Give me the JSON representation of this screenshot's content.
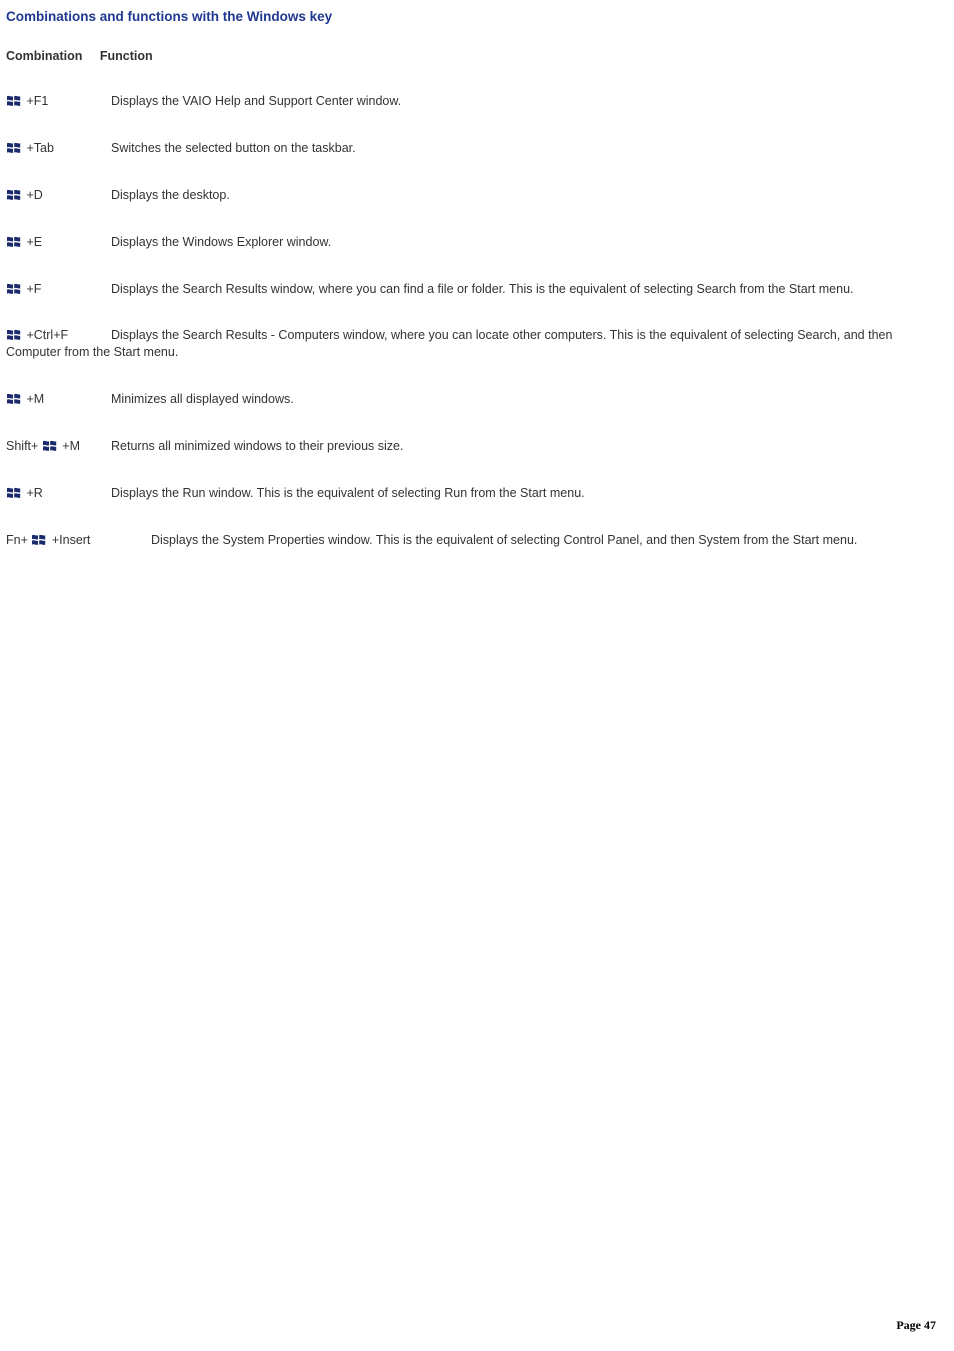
{
  "title": "Combinations and functions with the Windows key",
  "columns": {
    "a": "Combination",
    "b": "Function"
  },
  "rows": [
    {
      "prefix": "",
      "suffix": " +F1",
      "func": "Displays the VAIO Help and Support Center window."
    },
    {
      "prefix": "",
      "suffix": " +Tab",
      "func": "Switches the selected button on the taskbar."
    },
    {
      "prefix": "",
      "suffix": " +D",
      "func": "Displays the desktop."
    },
    {
      "prefix": "",
      "suffix": " +E",
      "func": "Displays the Windows Explorer window."
    },
    {
      "prefix": "",
      "suffix": " +F",
      "func": "Displays the Search Results window, where you can find a file or folder. This is the equivalent of selecting Search from the Start menu.",
      "flow": true
    },
    {
      "prefix": "",
      "suffix": " +Ctrl+F",
      "func": "Displays the Search Results - Computers window, where you can locate other computers. This is the equivalent of selecting Search, and then Computer from the Start menu.",
      "flow": true
    },
    {
      "prefix": "",
      "suffix": " +M",
      "func": "Minimizes all displayed windows."
    },
    {
      "prefix": "Shift+ ",
      "suffix": "  +M",
      "func": "Returns all minimized windows to their previous size."
    },
    {
      "prefix": "",
      "suffix": " +R",
      "func": "Displays the Run window. This is the equivalent of selecting Run from the Start menu."
    },
    {
      "prefix": "Fn+ ",
      "suffix": "  +Insert",
      "func": "Displays the System Properties window. This is the equivalent of selecting Control Panel, and then System from the Start menu.",
      "flow": true,
      "wide": true
    }
  ],
  "footer": {
    "label": "Page",
    "number": "47"
  }
}
